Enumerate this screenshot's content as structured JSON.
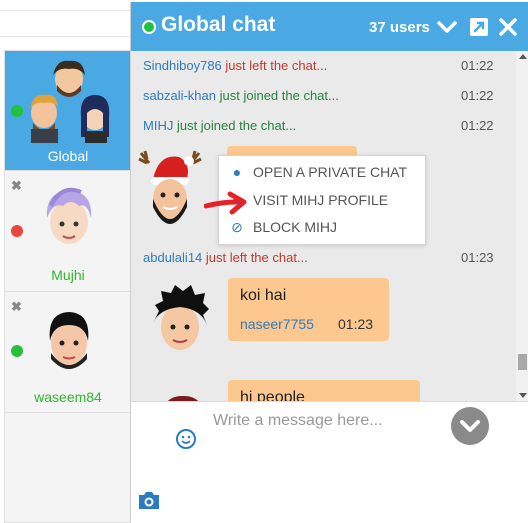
{
  "sidebar": {
    "items": [
      {
        "name": "Global",
        "status": "online"
      },
      {
        "name": "Mujhi",
        "status": "away"
      },
      {
        "name": "waseem84",
        "status": "online"
      }
    ]
  },
  "chat": {
    "title": "Global chat",
    "users": "37 users",
    "messages": [
      {
        "user": "Sindhiboy786",
        "action": " just left the chat...",
        "time": "01:22"
      },
      {
        "user": "sabzali-khan",
        "action": " just joined the chat...",
        "time": "01:22"
      },
      {
        "user": "MIHJ",
        "action": " just joined the chat...",
        "time": "01:22"
      },
      {
        "user": "abdulali14",
        "action": " just left the chat...",
        "time": "01:23"
      }
    ],
    "bubble1": {
      "text": "koi hai",
      "user": "naseer7755",
      "time": "01:23"
    },
    "bubble2": {
      "text": "hi people"
    },
    "context_menu": {
      "private": "OPEN A PRIVATE CHAT",
      "profile": "VISIT MIHJ PROFILE",
      "block": "BLOCK MIHJ"
    },
    "composer": {
      "placeholder": "Write a message here..."
    }
  },
  "colors": {
    "accent": "#4aa9e3",
    "bubble": "#fcc88f",
    "online": "#22c03c",
    "away": "#e8453c",
    "annotation": "#e8202a"
  }
}
